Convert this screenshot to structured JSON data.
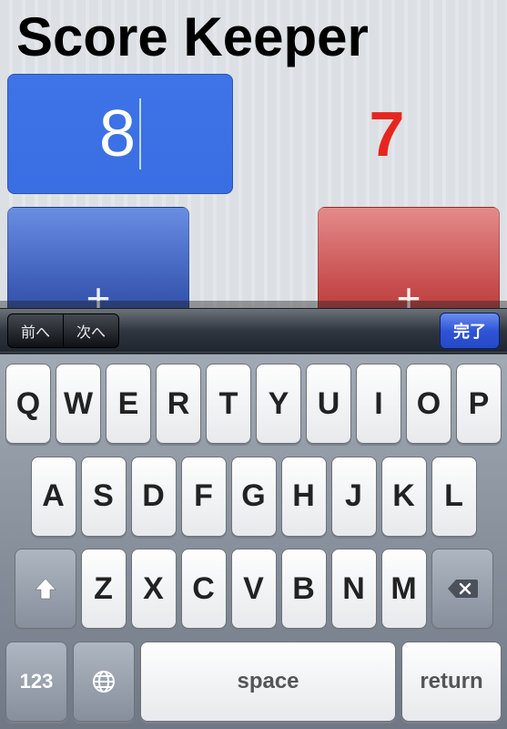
{
  "title": "Score Keeper",
  "scores": {
    "left": "8",
    "right": "7"
  },
  "buttons": {
    "left_plus": "+",
    "right_plus": "+"
  },
  "colors": {
    "blue": "#3c6fe4",
    "red": "#e6261e"
  },
  "toolbar": {
    "prev": "前へ",
    "next": "次へ",
    "done": "完了"
  },
  "keyboard": {
    "row1": [
      "Q",
      "W",
      "E",
      "R",
      "T",
      "Y",
      "U",
      "I",
      "O",
      "P"
    ],
    "row2": [
      "A",
      "S",
      "D",
      "F",
      "G",
      "H",
      "J",
      "K",
      "L"
    ],
    "row3": [
      "Z",
      "X",
      "C",
      "V",
      "B",
      "N",
      "M"
    ],
    "shift_icon": "shift-icon",
    "backspace_icon": "backspace-icon",
    "mode": "123",
    "globe_icon": "globe-icon",
    "space": "space",
    "return": "return"
  }
}
